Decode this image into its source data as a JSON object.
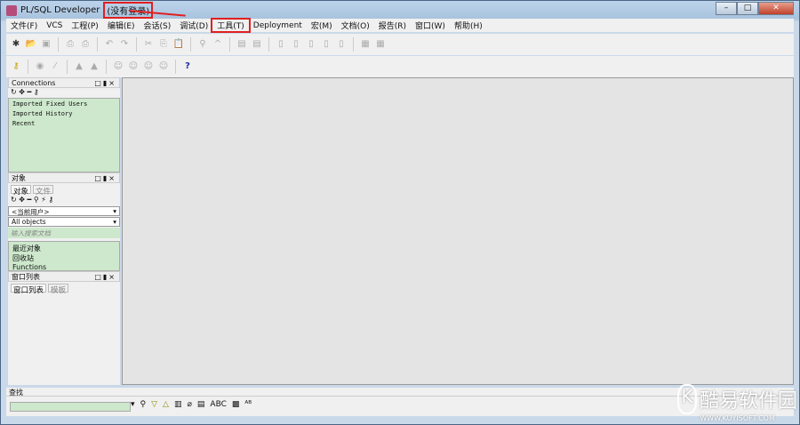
{
  "title": {
    "app": "PL/SQL Developer",
    "status": "(没有登录)"
  },
  "window_controls": {
    "minimize": "–",
    "maximize": "□",
    "close": "✕"
  },
  "menu": [
    "文件(F)",
    "VCS",
    "工程(P)",
    "编辑(E)",
    "会话(S)",
    "调试(D)",
    "工具(T)",
    "Deployment",
    "宏(M)",
    "文档(O)",
    "报告(R)",
    "窗口(W)",
    "帮助(H)"
  ],
  "highlighted_menu": "工具(T)",
  "connections": {
    "title": "Connections",
    "items": [
      "Imported Fixed Users",
      "Imported History",
      "Recent"
    ]
  },
  "objects": {
    "title": "对象",
    "tabs": [
      "对象",
      "文件"
    ],
    "user_select": "<当前用户>",
    "type_select": "All objects",
    "search_placeholder": "输入搜索文档",
    "items": [
      "最近对象",
      "回收站",
      "Functions"
    ]
  },
  "window_list": {
    "title": "窗口列表",
    "tabs": [
      "窗口列表",
      "模板"
    ]
  },
  "find": {
    "label": "查找",
    "icons": [
      "binoculars",
      "find-next",
      "find-previous",
      "highlight",
      "clear",
      "options",
      "ABC",
      "whole-word",
      "regex"
    ]
  },
  "help_icon": "?",
  "watermark": {
    "logo": "K",
    "name": "酷易软件园",
    "url": "WWW.KUYISOFT.COM"
  }
}
